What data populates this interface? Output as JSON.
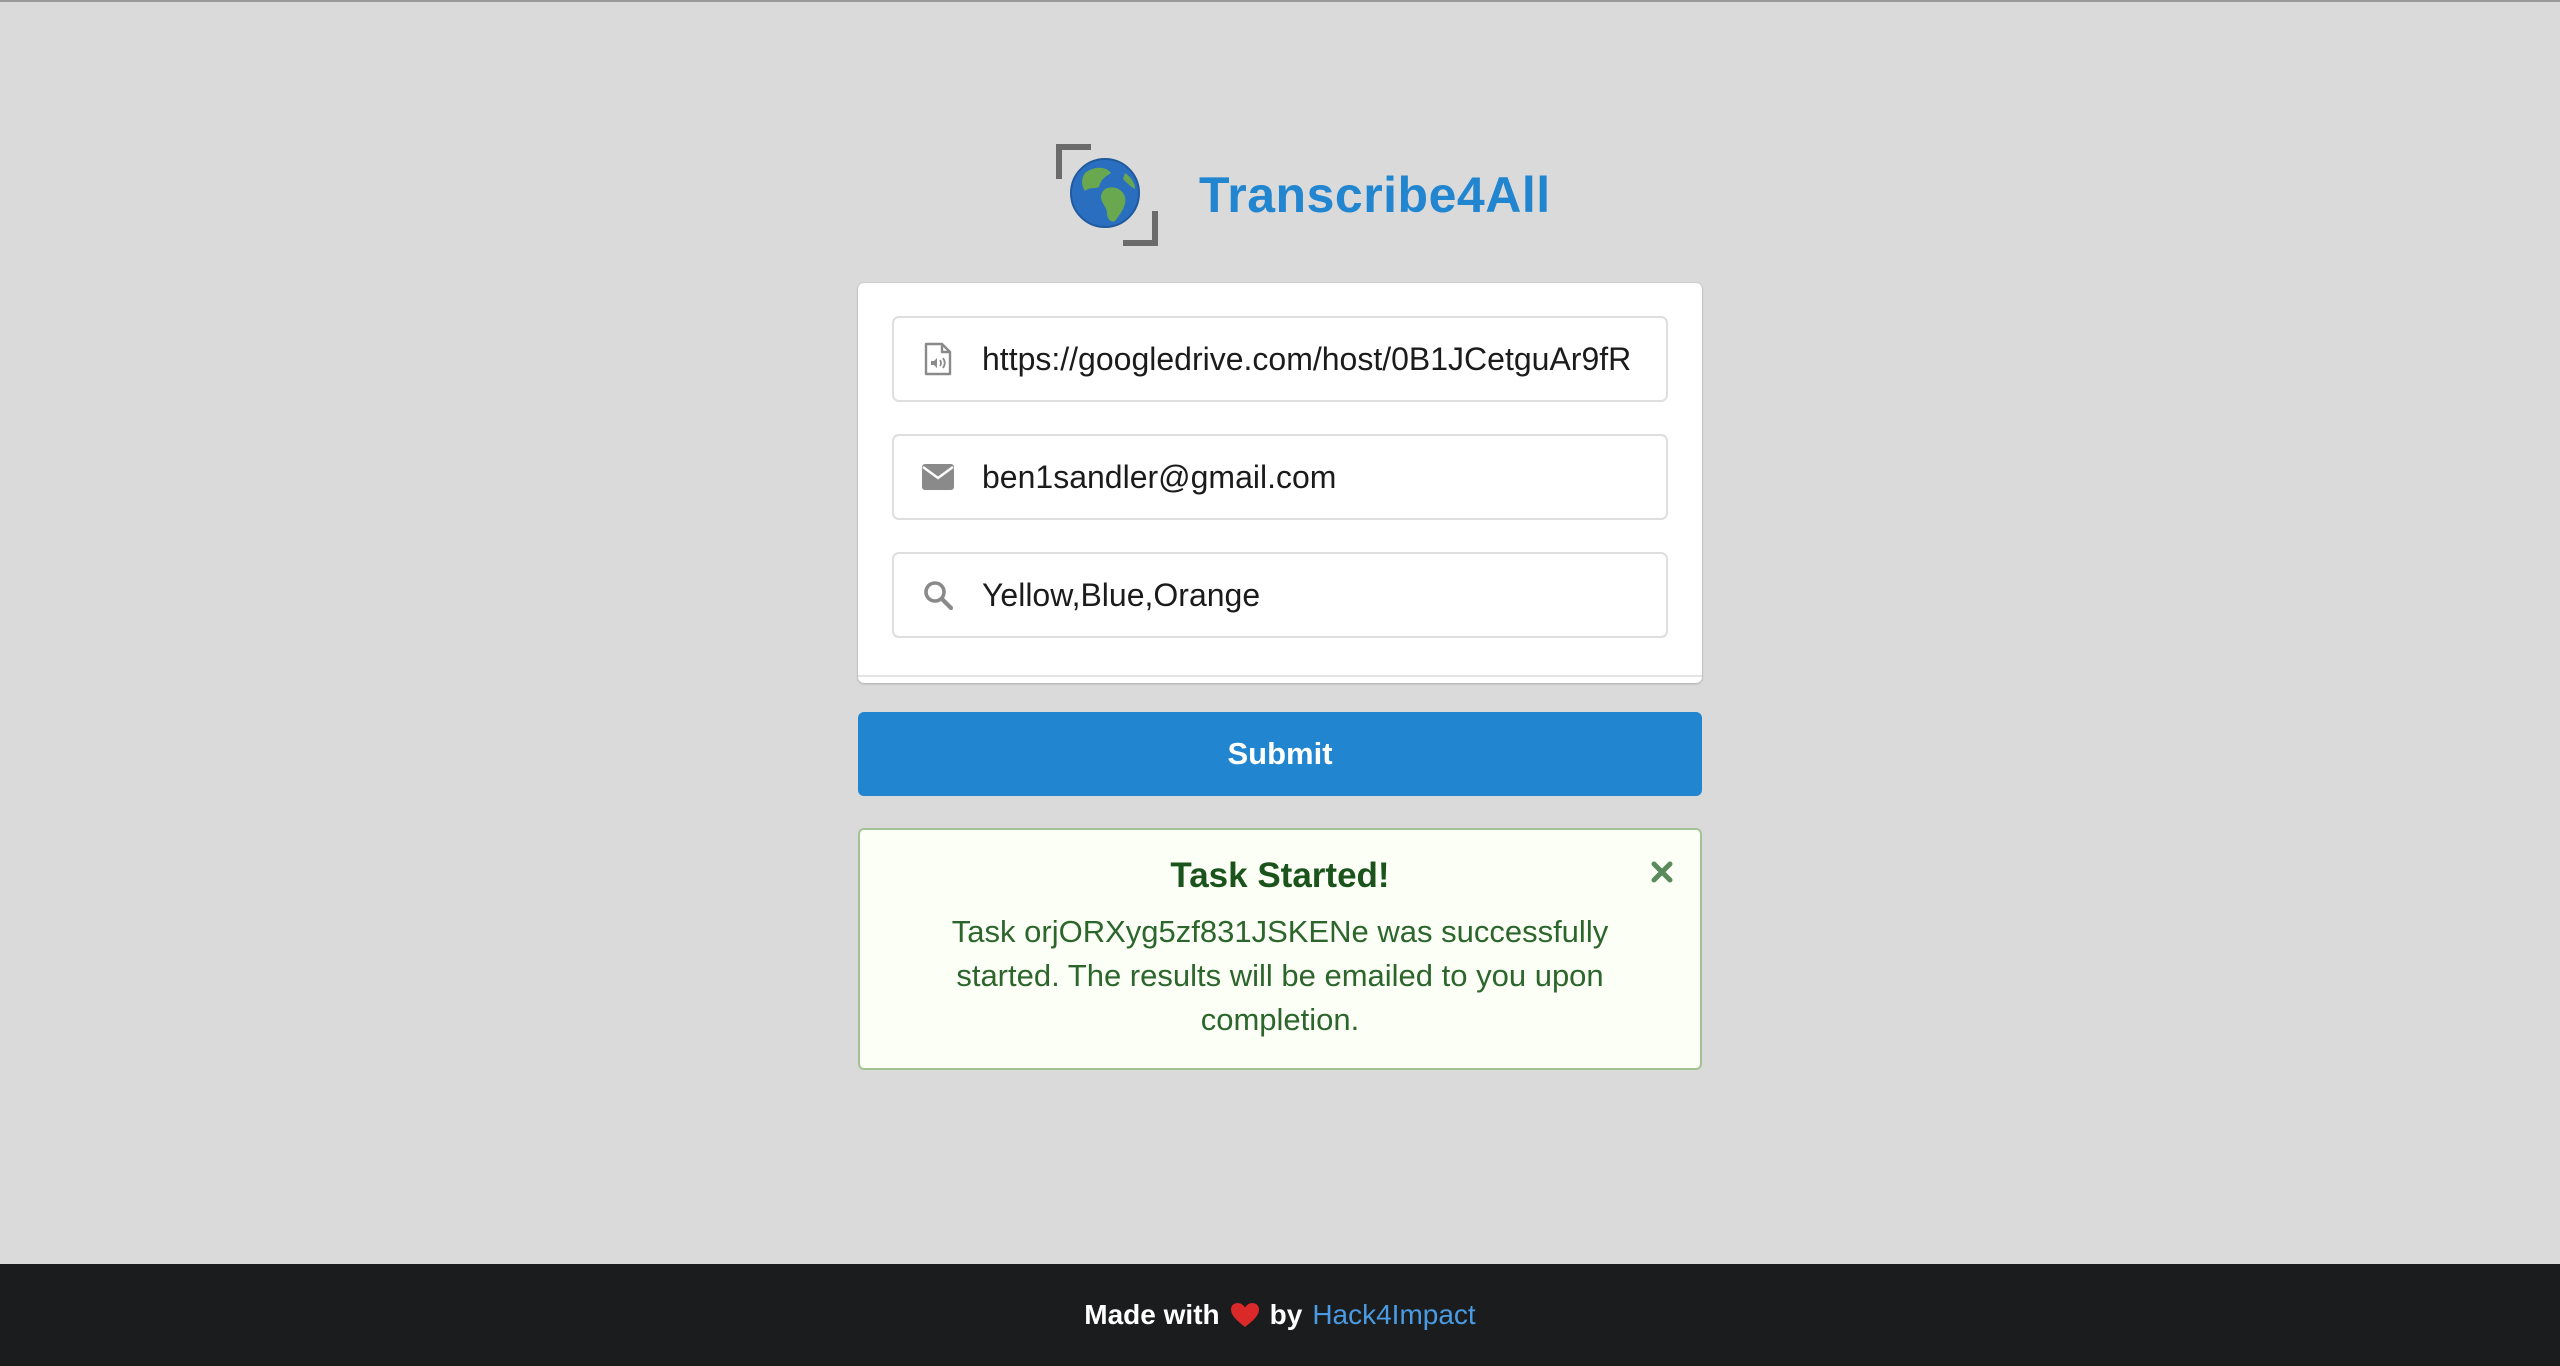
{
  "app": {
    "title": "Transcribe4All",
    "logo_icon": "globe-frame-icon"
  },
  "form": {
    "file_url": {
      "icon": "audio-file-icon",
      "value": "https://googledrive.com/host/0B1JCetguAr9fR"
    },
    "email": {
      "icon": "envelope-icon",
      "value": "ben1sandler@gmail.com"
    },
    "keywords": {
      "icon": "search-icon",
      "value": "Yellow,Blue,Orange"
    },
    "submit_label": "Submit"
  },
  "message": {
    "title": "Task Started!",
    "body": "Task orjORXyg5zf831JSKENe was successfully started. The results will be emailed to you upon completion.",
    "close_icon": "close-icon"
  },
  "footer": {
    "made_with": "Made with",
    "heart_icon": "heart-icon",
    "by": "by",
    "link_text": "Hack4Impact"
  },
  "colors": {
    "accent": "#2185d0",
    "background": "#dadada",
    "success_bg": "#fcfff5",
    "success_border": "#a3c293",
    "success_text": "#2c662d",
    "footer_bg": "#1b1c1d",
    "heart": "#db2828"
  }
}
